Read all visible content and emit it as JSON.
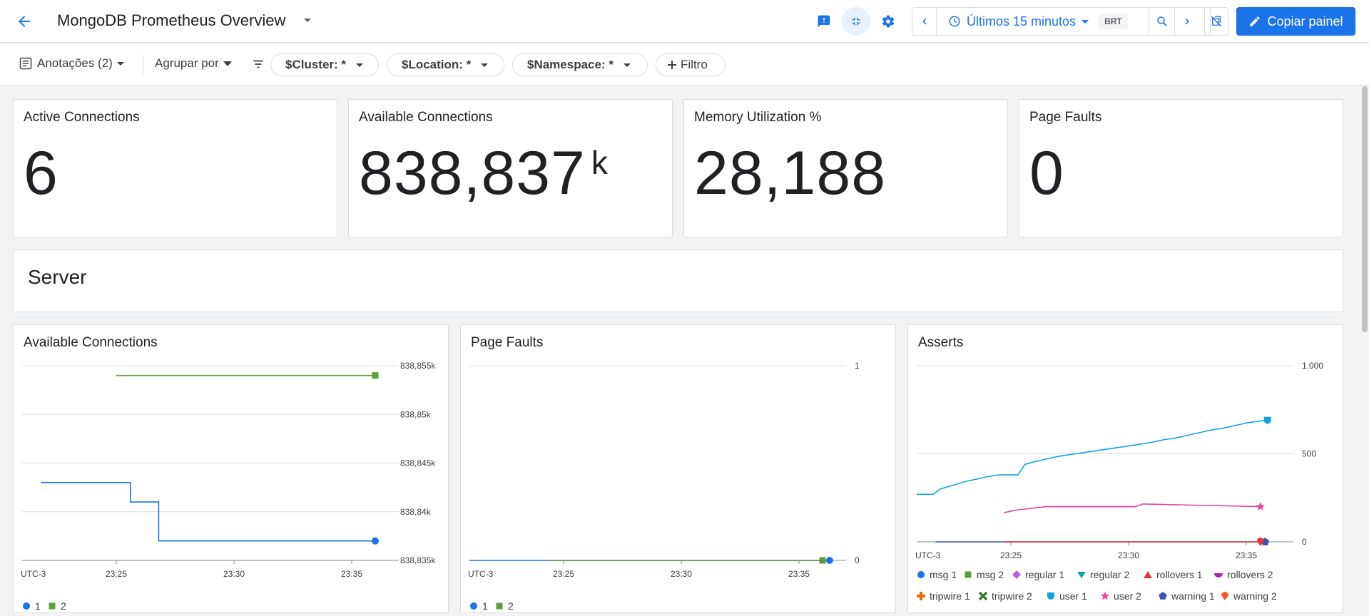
{
  "header": {
    "title": "MongoDB Prometheus Overview",
    "time_range": "Últimos 15 minutos",
    "timezone": "BRT",
    "copy_label": "Copiar painel"
  },
  "filters": {
    "annotations": "Anotações (2)",
    "group_by": "Agrupar por",
    "chips": [
      "$Cluster: *",
      "$Location: *",
      "$Namespace: *"
    ],
    "add_filter": "Filtro"
  },
  "scorecards": [
    {
      "title": "Active Connections",
      "value": "6",
      "unit": ""
    },
    {
      "title": "Available Connections",
      "value": "838,837",
      "unit": "k"
    },
    {
      "title": "Memory Utilization %",
      "value": "28,188",
      "unit": ""
    },
    {
      "title": "Page Faults",
      "value": "0",
      "unit": ""
    }
  ],
  "section": {
    "title": "Server"
  },
  "colors": {
    "accent": "#1a73e8",
    "series_blue": "#1a73e8",
    "series_green": "#5e9e36",
    "series_cyan": "#12a4e0",
    "series_pink": "#ee3f9a",
    "series_red": "#e53935",
    "series_navy": "#3f51b5"
  },
  "chart_data": [
    {
      "type": "line",
      "title": "Available Connections",
      "x_ticks": [
        "UTC-3",
        "23:25",
        "23:30",
        "23:35"
      ],
      "y_ticks": [
        "838,855k",
        "838,85k",
        "838,845k",
        "838,84k",
        "838,835k"
      ],
      "ylim": [
        838835,
        838857
      ],
      "legend": [
        "1",
        "2"
      ],
      "series": [
        {
          "name": "1",
          "x": [
            0.8,
            4.6,
            4.6,
            5.8,
            5.8,
            15.0
          ],
          "y": [
            838843,
            838843,
            838841,
            838841,
            838837,
            838837
          ]
        },
        {
          "name": "2",
          "x": [
            4.0,
            15.0
          ],
          "y": [
            838854,
            838854
          ]
        }
      ]
    },
    {
      "type": "line",
      "title": "Page Faults",
      "x_ticks": [
        "UTC-3",
        "23:25",
        "23:30",
        "23:35"
      ],
      "y_ticks": [
        "1",
        "0"
      ],
      "ylim": [
        0,
        1
      ],
      "legend": [
        "1",
        "2"
      ],
      "series": [
        {
          "name": "1",
          "x": [
            0,
            15.3
          ],
          "y": [
            0,
            0
          ]
        },
        {
          "name": "2",
          "x": [
            3.3,
            15.0
          ],
          "y": [
            0,
            0
          ]
        }
      ]
    },
    {
      "type": "line",
      "title": "Asserts",
      "x_ticks": [
        "UTC-3",
        "23:25",
        "23:30",
        "23:35"
      ],
      "y_ticks": [
        "1.000",
        "500",
        "0"
      ],
      "ylim": [
        0,
        1000
      ],
      "legend": [
        "msg 1",
        "msg 2",
        "regular 1",
        "regular 2",
        "rollovers 1",
        "rollovers 2",
        "tripwire 1",
        "tripwire 2",
        "user 1",
        "user 2",
        "warning 1",
        "warning 2"
      ],
      "series": [
        {
          "name": "user 1",
          "x": [
            0,
            0.7,
            1,
            1.5,
            2,
            2.5,
            3,
            3.5,
            4.3,
            4.6,
            5,
            5.5,
            6,
            6.5,
            7,
            7.5,
            8,
            8.5,
            9,
            9.5,
            10,
            10.5,
            11,
            11.5,
            12,
            12.5,
            13,
            13.5,
            14,
            14.5,
            14.9
          ],
          "y": [
            270,
            270,
            300,
            320,
            340,
            355,
            370,
            380,
            380,
            440,
            455,
            470,
            485,
            495,
            505,
            515,
            525,
            535,
            545,
            555,
            565,
            580,
            590,
            605,
            620,
            635,
            645,
            660,
            675,
            685,
            690
          ]
        },
        {
          "name": "user 2",
          "x": [
            3.7,
            4.2,
            5.5,
            9.3,
            9.6,
            14.6
          ],
          "y": [
            165,
            180,
            200,
            200,
            215,
            200
          ]
        },
        {
          "name": "warning 1",
          "x": [
            0.8,
            14.8
          ],
          "y": [
            0,
            0
          ]
        },
        {
          "name": "warning 2",
          "x": [
            3.7,
            14.6
          ],
          "y": [
            0,
            0
          ]
        }
      ]
    }
  ]
}
